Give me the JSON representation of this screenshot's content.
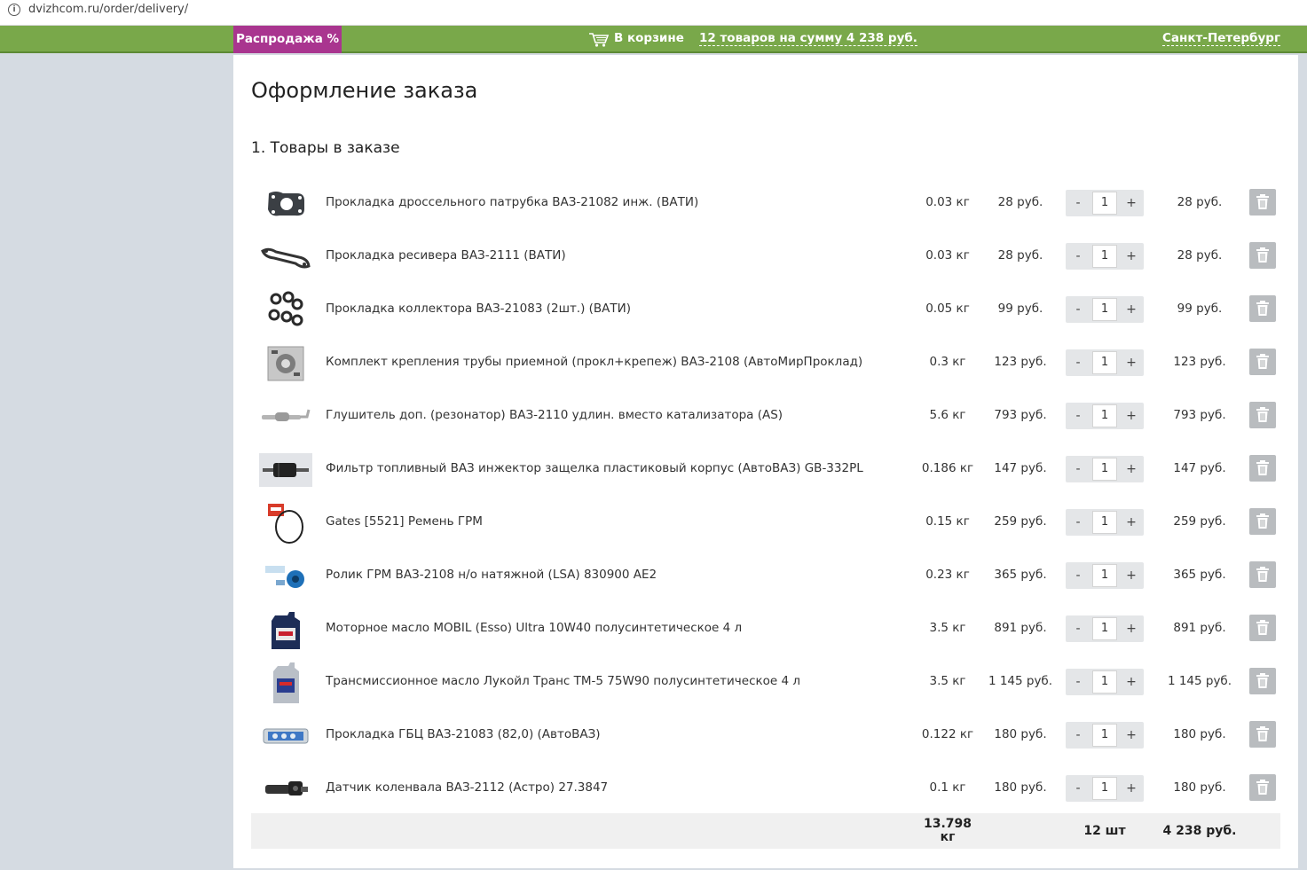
{
  "browser": {
    "url": "dvizhcom.ru/order/delivery/"
  },
  "topbar": {
    "sale_label": "Распродажа %",
    "cart_label": "В корзине",
    "cart_summary": "12 товаров на сумму 4 238 руб.",
    "city": "Санкт-Петербург",
    "colors": {
      "bar": "#79a84a",
      "sale": "#a9358f"
    }
  },
  "page": {
    "title": "Оформление заказа",
    "section_title": "1. Товары в заказе"
  },
  "items": [
    {
      "name": "Прокладка дроссельного патрубка ВАЗ-21082 инж. (ВАТИ)",
      "weight": "0.03 кг",
      "price": "28 руб.",
      "qty": "1",
      "total": "28 руб.",
      "icon": "gasket-icon"
    },
    {
      "name": "Прокладка ресивера ВАЗ-2111 (ВАТИ)",
      "weight": "0.03 кг",
      "price": "28 руб.",
      "qty": "1",
      "total": "28 руб.",
      "icon": "gasket-long-icon"
    },
    {
      "name": "Прокладка коллектора ВАЗ-21083 (2шт.) (ВАТИ)",
      "weight": "0.05 кг",
      "price": "99 руб.",
      "qty": "1",
      "total": "99 руб.",
      "icon": "manifold-gasket-icon"
    },
    {
      "name": "Комплект крепления трубы приемной (прокл+крепеж) ВАЗ-2108 (АвтоМирПроклад)",
      "weight": "0.3 кг",
      "price": "123 руб.",
      "qty": "1",
      "total": "123 руб.",
      "icon": "mount-kit-icon"
    },
    {
      "name": "Глушитель доп. (резонатор) ВАЗ-2110 удлин. вместо катализатора (AS)",
      "weight": "5.6 кг",
      "price": "793 руб.",
      "qty": "1",
      "total": "793 руб.",
      "icon": "muffler-icon"
    },
    {
      "name": "Фильтр топливный ВАЗ инжектор защелка пластиковый корпус (АвтоВАЗ) GB-332PL",
      "weight": "0.186 кг",
      "price": "147 руб.",
      "qty": "1",
      "total": "147 руб.",
      "icon": "fuel-filter-icon"
    },
    {
      "name": "Gates [5521] Ремень ГРМ",
      "weight": "0.15 кг",
      "price": "259 руб.",
      "qty": "1",
      "total": "259 руб.",
      "icon": "timing-belt-icon"
    },
    {
      "name": "Ролик ГРМ ВАЗ-2108 н/о натяжной (LSA) 830900 AE2",
      "weight": "0.23 кг",
      "price": "365 руб.",
      "qty": "1",
      "total": "365 руб.",
      "icon": "roller-icon"
    },
    {
      "name": "Моторное масло MOBIL (Esso) Ultra 10W40 полусинтетическое 4 л",
      "weight": "3.5 кг",
      "price": "891 руб.",
      "qty": "1",
      "total": "891 руб.",
      "icon": "oil-canister-icon"
    },
    {
      "name": "Трансмиссионное масло Лукойл Транс ТМ-5 75W90 полусинтетическое 4 л",
      "weight": "3.5 кг",
      "price": "1 145 руб.",
      "qty": "1",
      "total": "1 145 руб.",
      "icon": "oil-canister-silver-icon"
    },
    {
      "name": "Прокладка ГБЦ ВАЗ-21083 (82,0) (АвтоВАЗ)",
      "weight": "0.122 кг",
      "price": "180 руб.",
      "qty": "1",
      "total": "180 руб.",
      "icon": "head-gasket-icon"
    },
    {
      "name": "Датчик коленвала ВАЗ-2112 (Астро) 27.3847",
      "weight": "0.1 кг",
      "price": "180 руб.",
      "qty": "1",
      "total": "180 руб.",
      "icon": "sensor-icon"
    }
  ],
  "controls": {
    "minus": "-",
    "plus": "+"
  },
  "summary": {
    "weight_line1": "13.798",
    "weight_line2": "кг",
    "qty": "12 шт",
    "total": "4 238 руб."
  }
}
